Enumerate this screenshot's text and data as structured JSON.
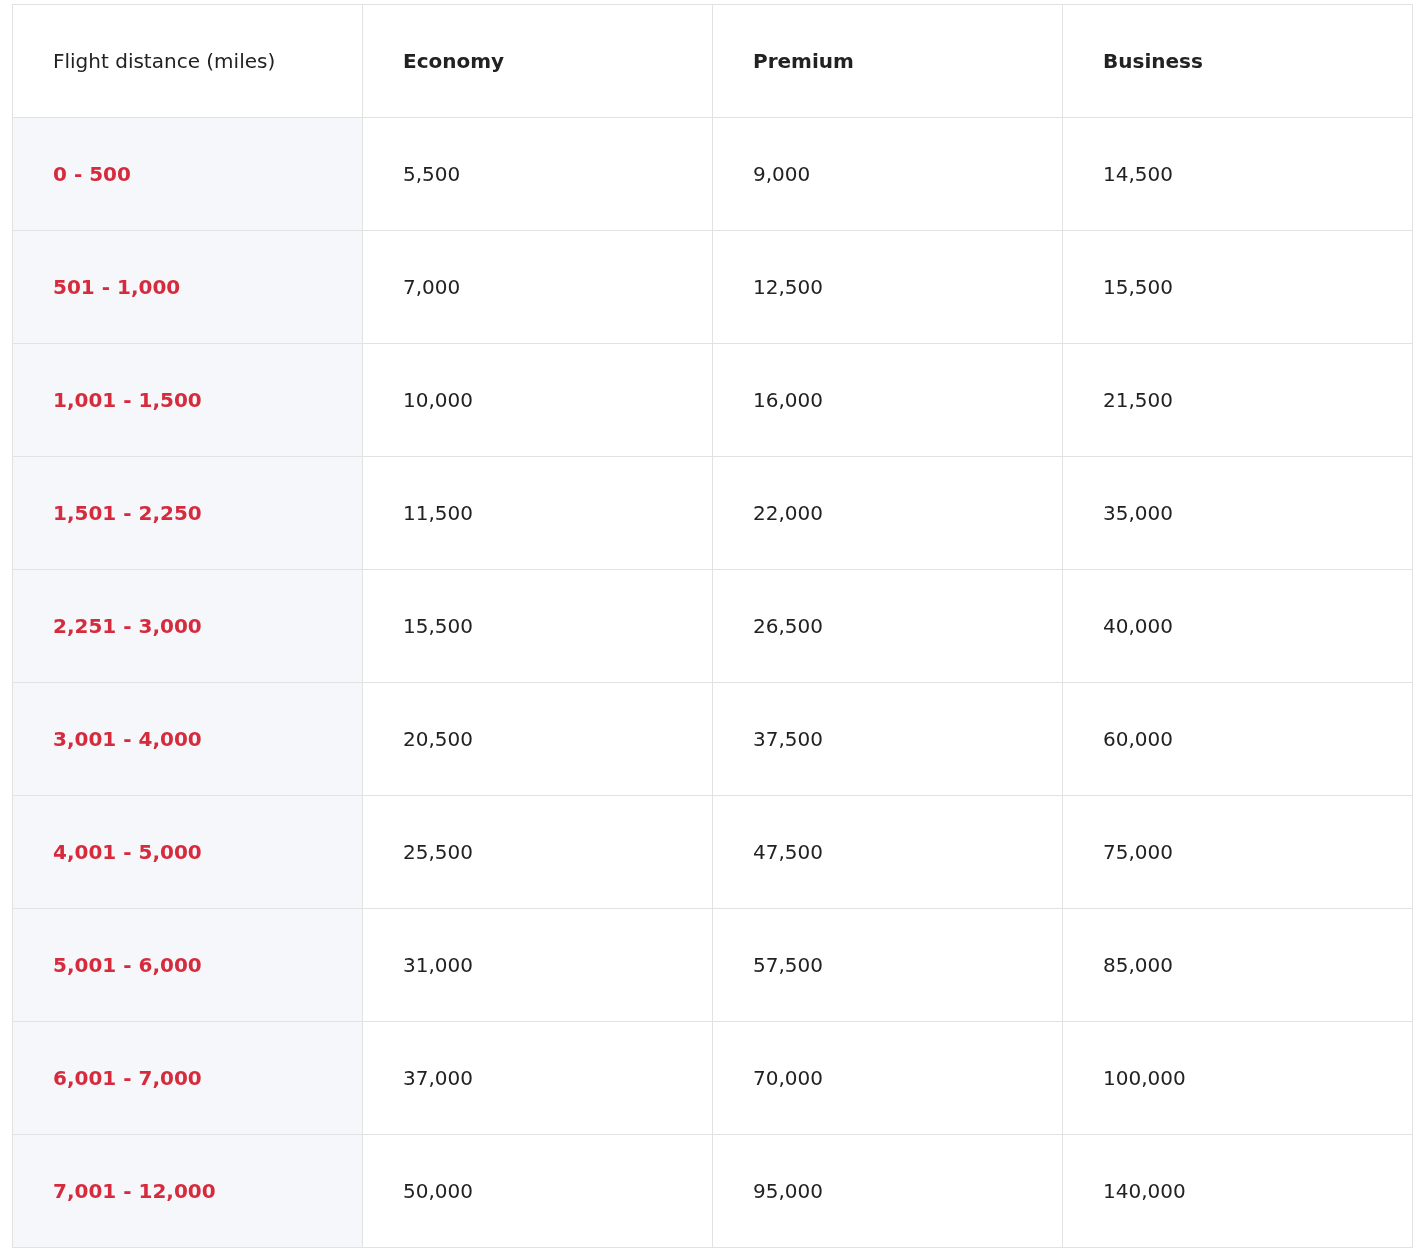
{
  "table": {
    "columns": [
      "Flight distance (miles)",
      "Economy",
      "Premium",
      "Business"
    ],
    "rows": [
      {
        "distance": "0 - 500",
        "values": [
          "5,500",
          "9,000",
          "14,500"
        ]
      },
      {
        "distance": "501 - 1,000",
        "values": [
          "7,000",
          "12,500",
          "15,500"
        ]
      },
      {
        "distance": "1,001 - 1,500",
        "values": [
          "10,000",
          "16,000",
          "21,500"
        ]
      },
      {
        "distance": "1,501 - 2,250",
        "values": [
          "11,500",
          "22,000",
          "35,000"
        ]
      },
      {
        "distance": "2,251 - 3,000",
        "values": [
          "15,500",
          "26,500",
          "40,000"
        ]
      },
      {
        "distance": "3,001 - 4,000",
        "values": [
          "20,500",
          "37,500",
          "60,000"
        ]
      },
      {
        "distance": "4,001 - 5,000",
        "values": [
          "25,500",
          "47,500",
          "75,000"
        ]
      },
      {
        "distance": "5,001 - 6,000",
        "values": [
          "31,000",
          "57,500",
          "85,000"
        ]
      },
      {
        "distance": "6,001 - 7,000",
        "values": [
          "37,000",
          "70,000",
          "100,000"
        ]
      },
      {
        "distance": "7,001 - 12,000",
        "values": [
          "50,000",
          "95,000",
          "140,000"
        ]
      }
    ]
  }
}
